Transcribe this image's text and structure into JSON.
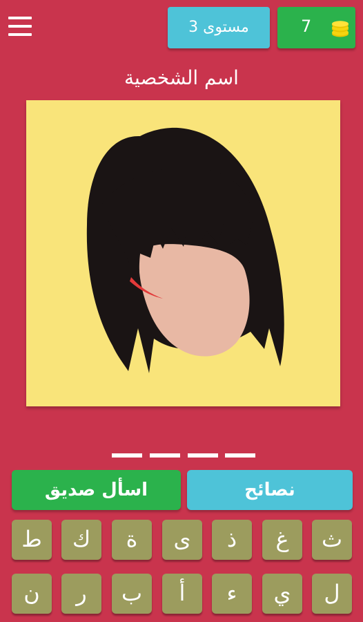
{
  "header": {
    "menu_icon": "hamburger-menu-icon",
    "coins": "7",
    "coin_icon": "coin-stack-icon",
    "level_label": "مستوى 3"
  },
  "title": "اسم الشخصية",
  "puzzle": {
    "image": "silhouette of a character with black bob haircut and bangs",
    "background_color": "#f9e47a"
  },
  "answer": {
    "letter_count": 4
  },
  "actions": {
    "hints_label": "نصائح",
    "ask_friend_label": "اسأل صديق"
  },
  "keyboard": {
    "row1": [
      "ث",
      "غ",
      "ذ",
      "ى",
      "ة",
      "ك",
      "ط"
    ],
    "row2": [
      "ل",
      "ي",
      "ء",
      "أ",
      "ب",
      "ر",
      "ن"
    ]
  },
  "colors": {
    "background": "#c9344d",
    "coins_badge": "#2bb24c",
    "level_badge": "#4ec3d8",
    "key": "#9c9c5e"
  }
}
